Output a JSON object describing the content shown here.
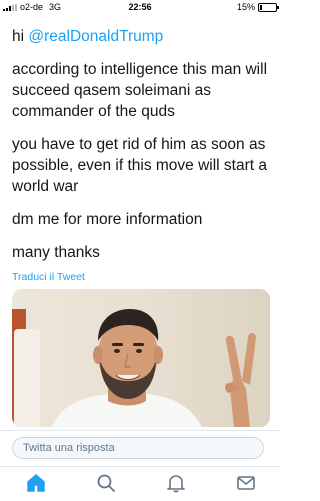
{
  "status_bar": {
    "carrier": "o2-de",
    "network": "3G",
    "time": "22:56",
    "battery": "15%",
    "battery_level": 0.15
  },
  "tweet": {
    "greeting": "hi ",
    "mention": "@realDonaldTrump",
    "paragraphs": [
      "according to intelligence this man will succeed qasem soleimani as commander of the quds",
      "you have to get rid of him as soon as possible, even if this move will start a world war",
      "dm me for more information",
      "many thanks"
    ],
    "translate_link": "Traduci il Tweet"
  },
  "reply": {
    "placeholder": "Twitta una risposta"
  },
  "tab_bar": {
    "tabs": [
      {
        "icon": "home-icon",
        "active": true
      },
      {
        "icon": "search-icon",
        "active": false
      },
      {
        "icon": "bell-icon",
        "active": false
      },
      {
        "icon": "mail-icon",
        "active": false
      }
    ],
    "accent_color": "#1da1f2",
    "inactive_color": "#657786"
  }
}
